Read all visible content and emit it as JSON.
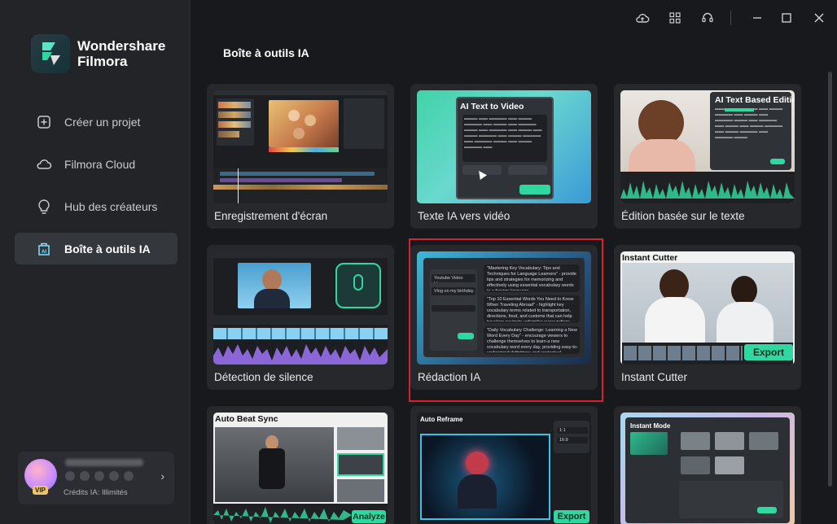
{
  "app": {
    "brand_line1": "Wondershare",
    "brand_line2": "Filmora"
  },
  "sidebar": {
    "items": [
      {
        "label": "Créer un projet",
        "icon": "plus-square-icon",
        "active": false
      },
      {
        "label": "Filmora Cloud",
        "icon": "cloud-icon",
        "active": false
      },
      {
        "label": "Hub des créateurs",
        "icon": "lightbulb-icon",
        "active": false
      },
      {
        "label": "Boîte à outils IA",
        "icon": "ai-toolbox-icon",
        "active": true
      }
    ],
    "user": {
      "badge": "VIP",
      "credits": "Crédits IA: Illimités"
    }
  },
  "titlebar": {
    "icons": [
      "cloud-upload-icon",
      "grid-icon",
      "headset-icon",
      "minimize-icon",
      "maximize-icon",
      "close-icon"
    ]
  },
  "main": {
    "section_title": "Boîte à outils IA",
    "cards": [
      {
        "label": "Enregistrement d'écran"
      },
      {
        "label": "Texte IA vers vidéo",
        "thumb_caption": "AI Text to Video"
      },
      {
        "label": "Édition basée sur le texte",
        "thumb_caption": "AI Text Based Editing"
      },
      {
        "label": "Détection de silence"
      },
      {
        "label": "Rédaction IA",
        "selected": true,
        "thumb_fields": [
          "Youtube Video Ideas",
          "Vlog on my birthday"
        ],
        "thumb_ideas": [
          "\"Mastering Key Vocabulary: Tips and Techniques for Language Learners\" - provide tips and strategies for memorizing and effectively using essential vocabulary words in a foreign language.",
          "\"Top 10 Essential Words You Need to Know When Traveling Abroad\" - highlight key vocabulary terms related to transportation, directions, food, and customs that can help travelers navigate unfamiliar surroundings with ease.",
          "\"Daily Vocabulary Challenge: Learning a New Word Every Day\" - encourage viewers to challenge themselves to learn a new vocabulary word every day, providing easy-to-understand definitions and contextual examples to help solidify their understanding."
        ]
      },
      {
        "label": "Instant Cutter",
        "thumb_caption": "Instant Cutter",
        "thumb_button": "Export"
      },
      {
        "label": "",
        "thumb_caption": "Auto Beat Sync",
        "thumb_button": "Analyze"
      },
      {
        "label": "",
        "thumb_caption": "Auto Reframe",
        "thumb_button": "Export",
        "ratios": [
          "1:1",
          "16:9"
        ]
      },
      {
        "label": "",
        "thumb_caption": "Instant Mode"
      }
    ]
  },
  "colors": {
    "accent_green": "#2fd8a0",
    "selection_red": "#d4242b",
    "sidebar_bg": "#222428",
    "main_bg": "#17191c"
  }
}
